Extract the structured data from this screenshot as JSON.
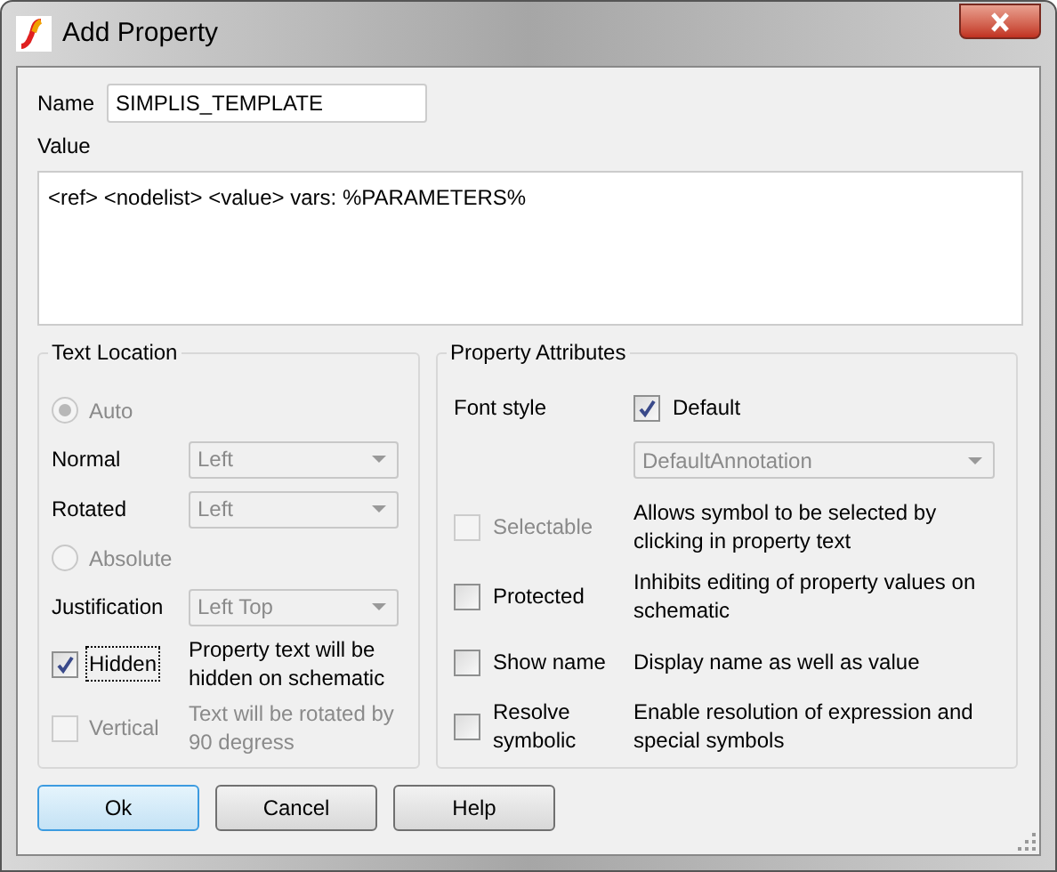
{
  "window": {
    "title": "Add Property"
  },
  "name_field": {
    "label": "Name",
    "value": "SIMPLIS_TEMPLATE"
  },
  "value_field": {
    "label": "Value",
    "value": "<ref> <nodelist> <value> vars: %PARAMETERS%"
  },
  "text_location": {
    "title": "Text Location",
    "rows": [
      {
        "kind": "radio",
        "label": "Auto",
        "selected": true,
        "disabled": true
      },
      {
        "kind": "dropdown",
        "label": "Normal",
        "value": "Left",
        "disabled": true
      },
      {
        "kind": "dropdown",
        "label": "Rotated",
        "value": "Left",
        "disabled": true
      },
      {
        "kind": "radio",
        "label": "Absolute",
        "selected": false,
        "disabled": true
      },
      {
        "kind": "dropdown",
        "label": "Justification",
        "value": "Left Top",
        "disabled": true
      },
      {
        "kind": "checkbox",
        "label": "Hidden",
        "checked": true,
        "disabled": false,
        "focused": true,
        "description": "Property text will be hidden on schematic"
      },
      {
        "kind": "checkbox",
        "label": "Vertical",
        "checked": false,
        "disabled": true,
        "focused": false,
        "description": "Text will be rotated by 90 degress"
      }
    ]
  },
  "property_attributes": {
    "title": "Property Attributes",
    "font_style": {
      "label": "Font style",
      "checkbox_label": "Default",
      "checked": true,
      "dropdown_value": "DefaultAnnotation",
      "dropdown_disabled": true
    },
    "options": [
      {
        "label": "Selectable",
        "checked": false,
        "disabled": true,
        "description": "Allows symbol to be selected by clicking in property text"
      },
      {
        "label": "Protected",
        "checked": false,
        "disabled": false,
        "description": "Inhibits editing of property values on schematic"
      },
      {
        "label": "Show name",
        "checked": false,
        "disabled": false,
        "description": "Display name as well as value"
      },
      {
        "label": "Resolve symbolic",
        "checked": false,
        "disabled": false,
        "description": "Enable resolution of expression and special symbols"
      }
    ]
  },
  "buttons": [
    {
      "label": "Ok",
      "default": true
    },
    {
      "label": "Cancel",
      "default": false
    },
    {
      "label": "Help",
      "default": false
    }
  ]
}
